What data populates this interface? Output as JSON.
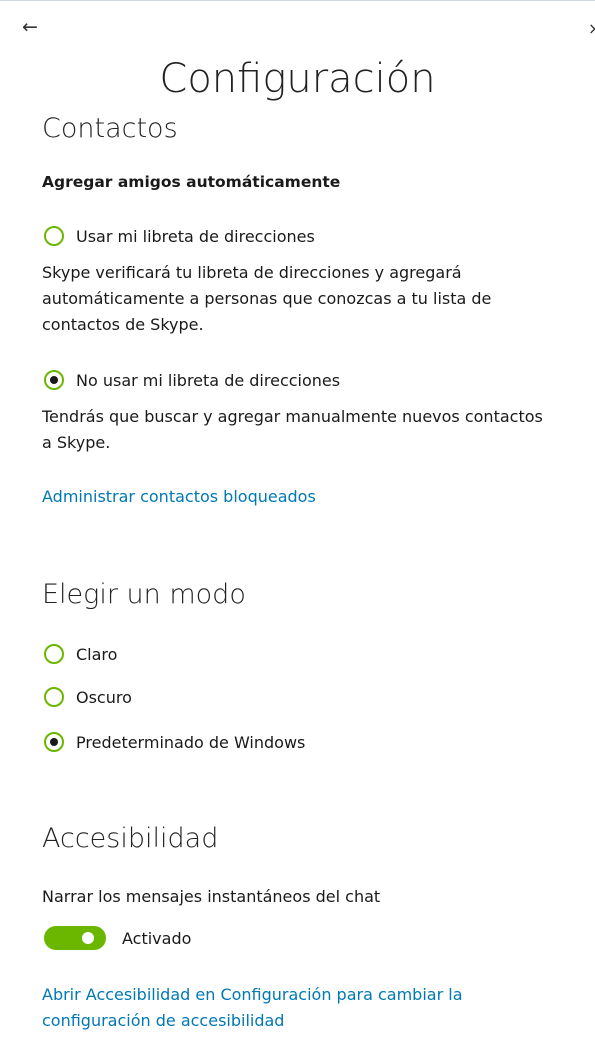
{
  "nav": {
    "back_glyph": "←",
    "close_glyph": "×"
  },
  "page_title": "Configuración",
  "contacts": {
    "title": "Contactos",
    "subheading": "Agregar amigos automáticamente",
    "options": [
      {
        "label": "Usar mi libreta de direcciones",
        "selected": false,
        "description": "Skype verificará tu libreta de direcciones y agregará automáticamente a personas que conozcas a tu lista de contactos de Skype."
      },
      {
        "label": "No usar mi libreta de direcciones",
        "selected": true,
        "description": "Tendrás que buscar y agregar manualmente nuevos contactos a Skype."
      }
    ],
    "blocked_link": "Administrar contactos bloqueados"
  },
  "mode": {
    "title": "Elegir un modo",
    "options": [
      {
        "label": "Claro",
        "selected": false
      },
      {
        "label": "Oscuro",
        "selected": false
      },
      {
        "label": "Predeterminado de Windows",
        "selected": true
      }
    ]
  },
  "accessibility": {
    "title": "Accesibilidad",
    "narrate_label": "Narrar los mensajes instantáneos del chat",
    "toggle_state": "Activado",
    "toggle_on": true,
    "settings_link": "Abrir Accesibilidad en Configuración para cambiar la configuración de accesibilidad"
  },
  "colors": {
    "accent_green": "#6bb700",
    "link_blue": "#0078b4"
  }
}
